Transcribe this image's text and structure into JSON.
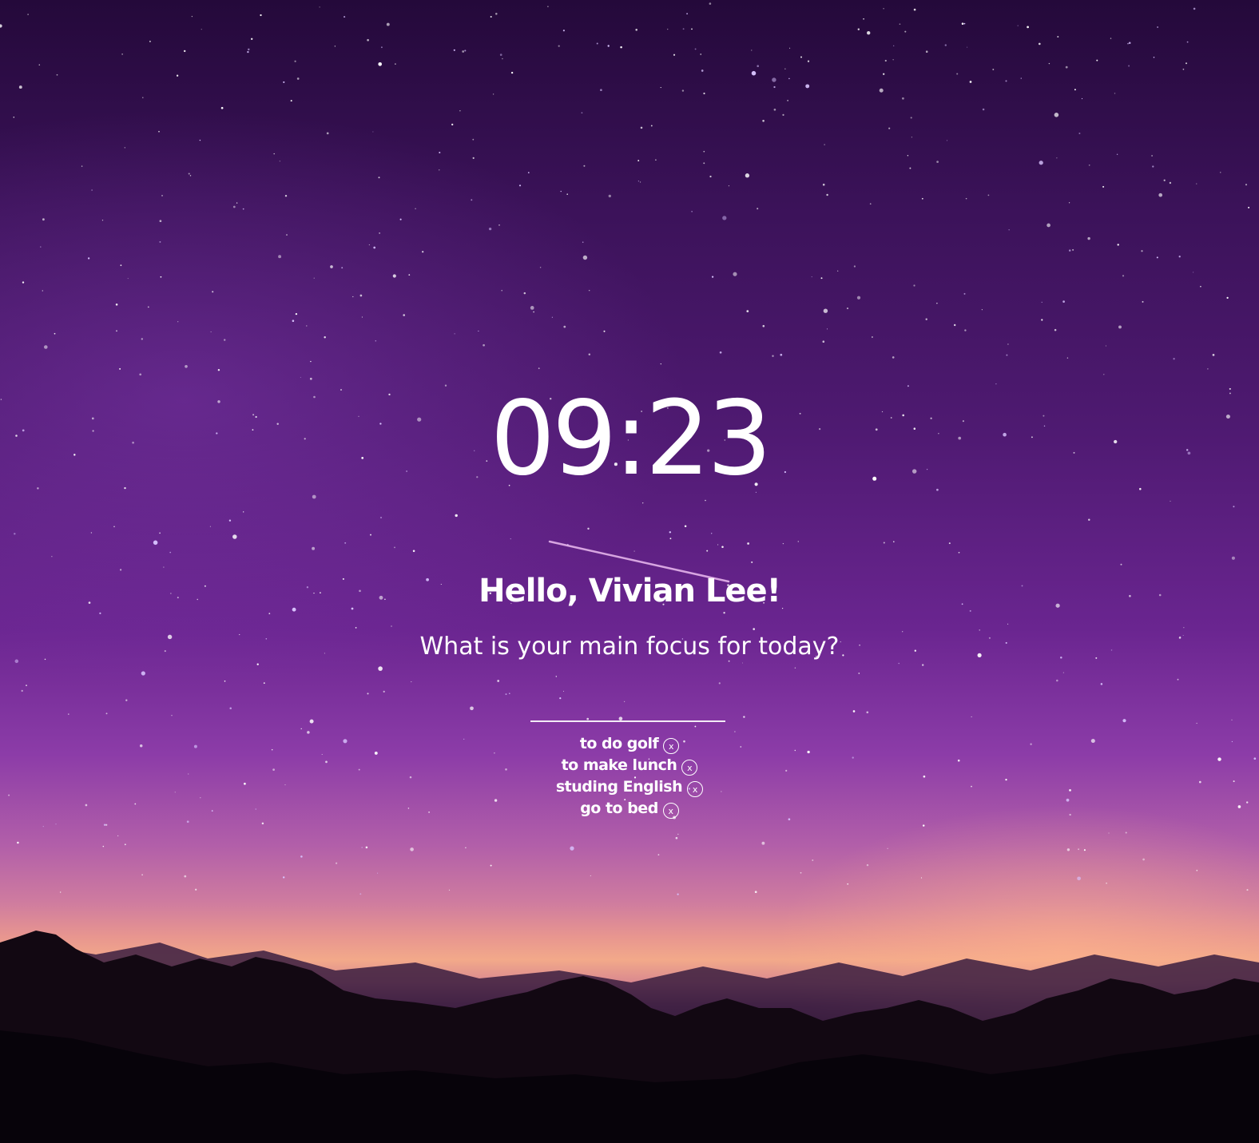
{
  "clock": {
    "time": "09:23"
  },
  "greeting": {
    "text": "Hello, Vivian Lee!"
  },
  "focus": {
    "question": "What is your main focus for today?",
    "input_value": ""
  },
  "todos": [
    {
      "text": "to do golf",
      "delete_label": "x"
    },
    {
      "text": "to make lunch",
      "delete_label": "x"
    },
    {
      "text": "studing English",
      "delete_label": "x"
    },
    {
      "text": "go to bed",
      "delete_label": "x"
    }
  ],
  "background": {
    "scene": "night sky with stars over mountains",
    "colors": {
      "sky_top": "#24093a",
      "sky_mid": "#6a2590",
      "horizon_glow": "#f2a98a",
      "mountains": "#140a18",
      "text": "#ffffff"
    }
  }
}
